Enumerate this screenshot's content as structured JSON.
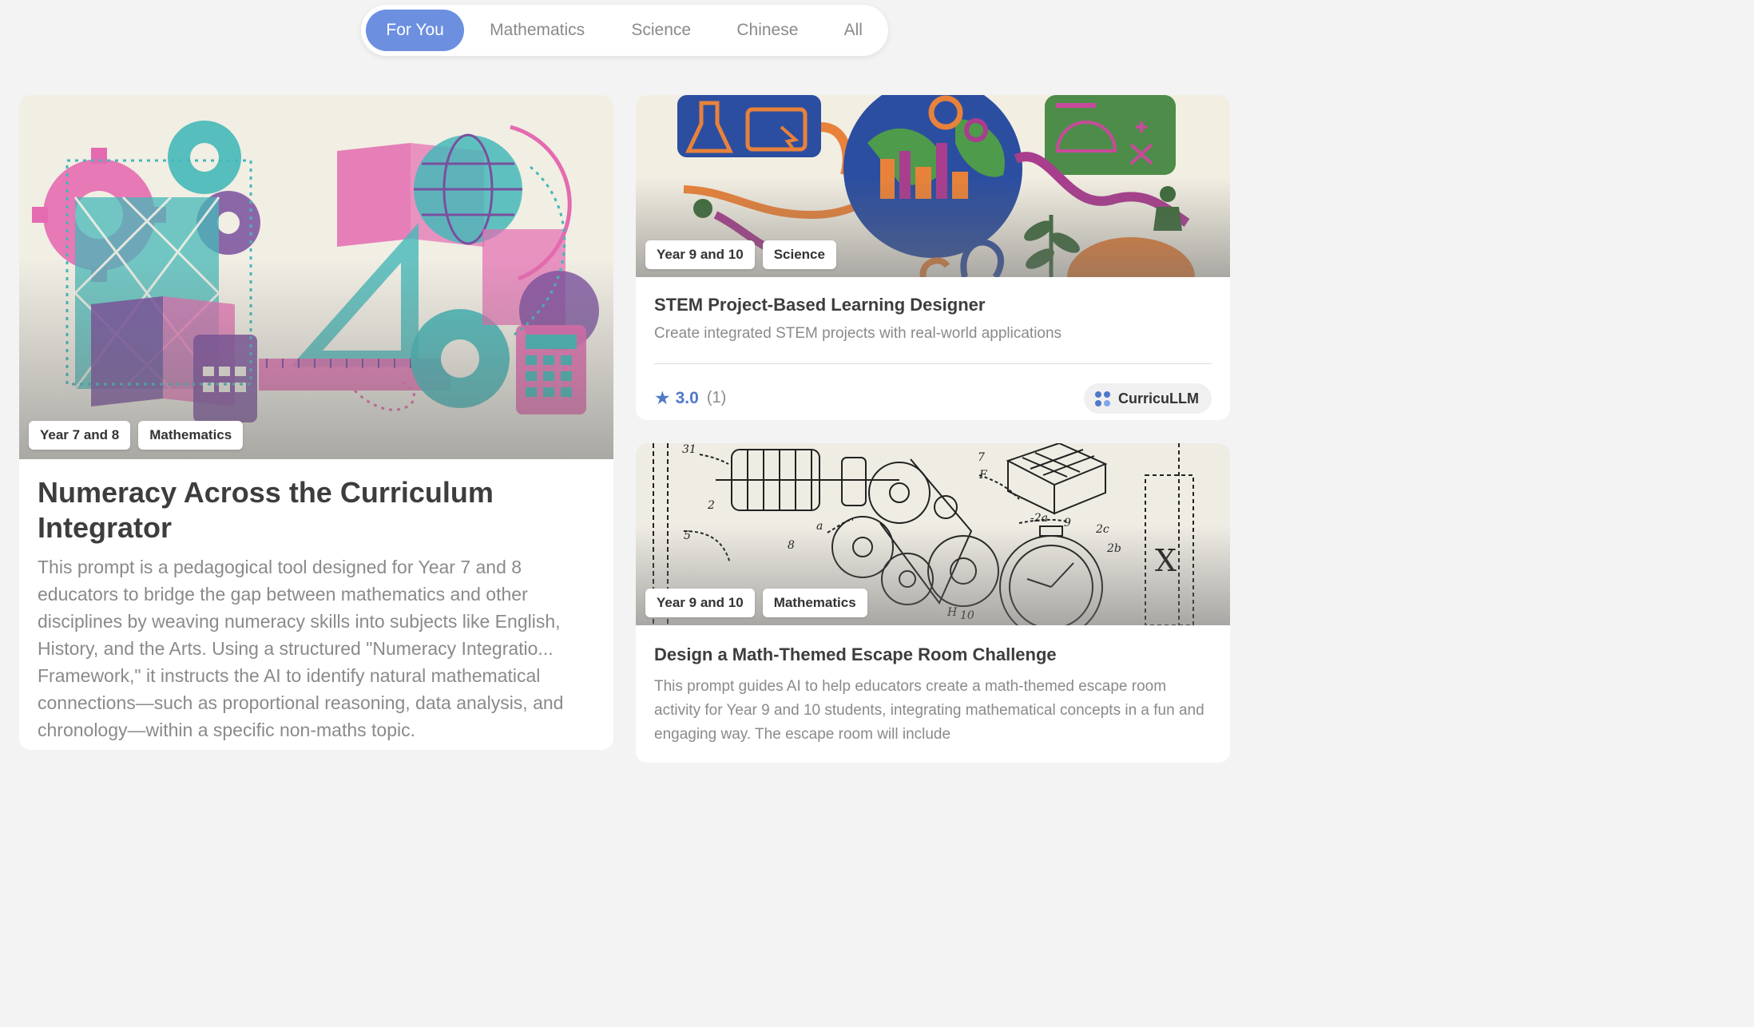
{
  "tabs": [
    {
      "label": "For You",
      "active": true
    },
    {
      "label": "Mathematics",
      "active": false
    },
    {
      "label": "Science",
      "active": false
    },
    {
      "label": "Chinese",
      "active": false
    },
    {
      "label": "All",
      "active": false
    }
  ],
  "cards": [
    {
      "tags": [
        "Year 7 and 8",
        "Mathematics"
      ],
      "title": "Numeracy Across the Curriculum Integrator",
      "description": "This prompt is a pedagogical tool designed for Year 7 and 8 educators to bridge the gap between mathematics and other disciplines by weaving numeracy skills into subjects like English, History, and the Arts. Using a structured \"Numeracy Integratio... Framework,\" it instructs the AI to identify natural mathematical connections—such as proportional reasoning, data analysis, and chronology—within a specific non-maths topic."
    },
    {
      "tags": [
        "Year 9 and 10",
        "Science"
      ],
      "title": "STEM Project-Based Learning Designer",
      "description": "Create integrated STEM projects with real-world applications",
      "rating": "3.0",
      "rating_count": "(1)",
      "author": "CurricuLLM"
    },
    {
      "tags": [
        "Year 9 and 10",
        "Mathematics"
      ],
      "title": "Design a Math-Themed Escape Room Challenge",
      "description": "This prompt guides AI to help educators create a math-themed escape room activity for Year 9 and 10 students, integrating mathematical concepts in a fun and engaging way. The escape room will include"
    }
  ],
  "illustration_labels": [
    "31",
    "2",
    "5",
    "8",
    "a",
    "7",
    "F",
    "9",
    "-2a",
    "2c",
    "2b",
    "X",
    "H",
    "10"
  ],
  "colors": {
    "accent": "#6c8fe0",
    "rating": "#4f78c8",
    "pink": "#e05aa8",
    "teal": "#45b8b8",
    "purple": "#7a4f9e"
  },
  "icons": [
    "star-icon",
    "curricullm-logo-icon"
  ]
}
